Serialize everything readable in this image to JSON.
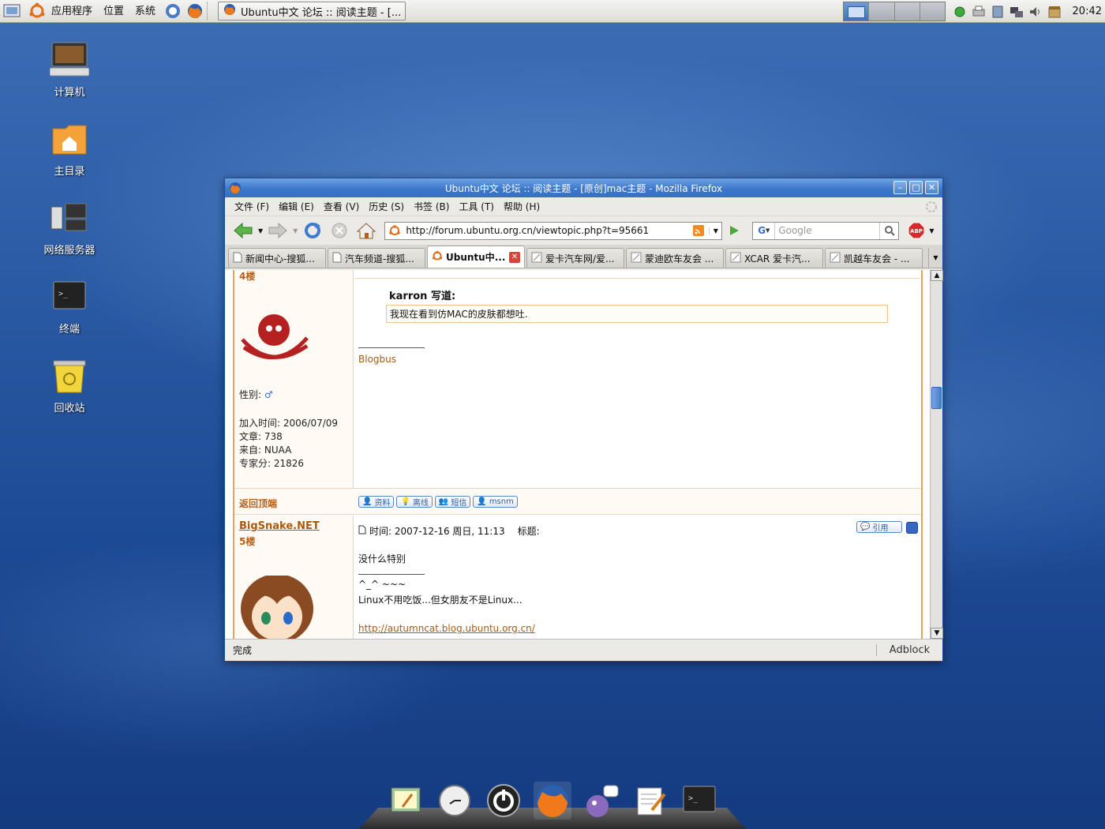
{
  "top_panel": {
    "menus": [
      "应用程序",
      "位置",
      "系统"
    ],
    "taskbar_window": "Ubuntu中文 论坛 :: 阅读主题 - [...",
    "clock": "20:42"
  },
  "desktop": {
    "icons": [
      "计算机",
      "主目录",
      "网络服务器",
      "终端",
      "回收站"
    ]
  },
  "window": {
    "title": "Ubuntu中文 论坛 :: 阅读主题 - [原创]mac主题 - Mozilla Firefox",
    "menu": [
      "文件 (F)",
      "编辑 (E)",
      "查看 (V)",
      "历史 (S)",
      "书签 (B)",
      "工具 (T)",
      "帮助 (H)"
    ],
    "url": "http://forum.ubuntu.org.cn/viewtopic.php?t=95661",
    "search_placeholder": "Google",
    "tabs": [
      "新闻中心-搜狐...",
      "汽车频道-搜狐...",
      "Ubuntu中...",
      "爱卡汽车网/爱...",
      "蒙迪欧车友会 ...",
      "XCAR 爱卡汽...",
      "凯越车友会 - ..."
    ],
    "status": "完成",
    "adblock": "Adblock"
  },
  "post1": {
    "floor": "4楼",
    "gender_label": "性别:",
    "join": "加入时间: 2006/07/09",
    "posts": "文章: 738",
    "from": "来自: NUAA",
    "score": "专家分: 21826",
    "quote_author": "karron 写道:",
    "quote_text": "我现在看到仿MAC的皮肤都想吐.",
    "sig_link": "Blogbus",
    "back_to_top": "返回顶端",
    "buttons": [
      "资料",
      "离线",
      "短信",
      "msnm"
    ]
  },
  "post2": {
    "username": "BigSnake.NET",
    "floor": "5楼",
    "time": "时间: 2007-12-16 周日, 11:13",
    "subject_label": "标题:",
    "quote_btn": "引用",
    "body": "没什么特别",
    "sig_line1": "^_^ ~~~",
    "sig_line2": "Linux不用吃饭...但女朋友不是Linux...",
    "sig_link": "http://autumncat.blog.ubuntu.org.cn/"
  }
}
